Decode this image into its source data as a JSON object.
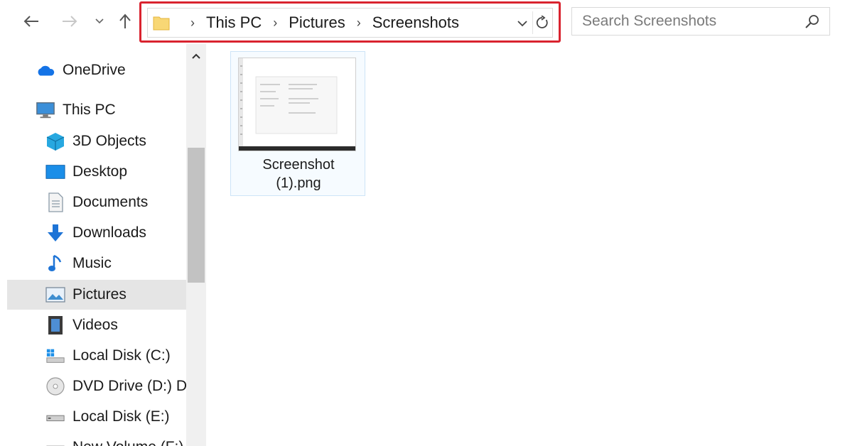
{
  "toolbar": {
    "back_icon": "back-arrow-icon",
    "forward_icon": "forward-arrow-icon",
    "recent_icon": "chevron-down-icon",
    "up_icon": "up-arrow-icon"
  },
  "address": {
    "crumbs": [
      "This PC",
      "Pictures",
      "Screenshots"
    ],
    "highlight_color": "#d9232f"
  },
  "search": {
    "placeholder": "Search Screenshots"
  },
  "sidebar": {
    "items": [
      {
        "label": "OneDrive",
        "icon": "cloud-icon"
      },
      {
        "label": "This PC",
        "icon": "computer-icon"
      },
      {
        "label": "3D Objects",
        "icon": "cube-icon"
      },
      {
        "label": "Desktop",
        "icon": "desktop-icon"
      },
      {
        "label": "Documents",
        "icon": "document-icon"
      },
      {
        "label": "Downloads",
        "icon": "download-arrow-icon"
      },
      {
        "label": "Music",
        "icon": "music-note-icon"
      },
      {
        "label": "Pictures",
        "icon": "pictures-icon"
      },
      {
        "label": "Videos",
        "icon": "film-icon"
      },
      {
        "label": "Local Disk (C:)",
        "icon": "windows-drive-icon"
      },
      {
        "label": "DVD Drive (D:) D",
        "icon": "dvd-icon"
      },
      {
        "label": "Local Disk (E:)",
        "icon": "drive-icon"
      },
      {
        "label": "New Volume (F:)",
        "icon": "drive-icon"
      }
    ],
    "selected": "Pictures"
  },
  "files": [
    {
      "name_line1": "Screenshot",
      "name_line2": "(1).png",
      "type": "png"
    }
  ]
}
